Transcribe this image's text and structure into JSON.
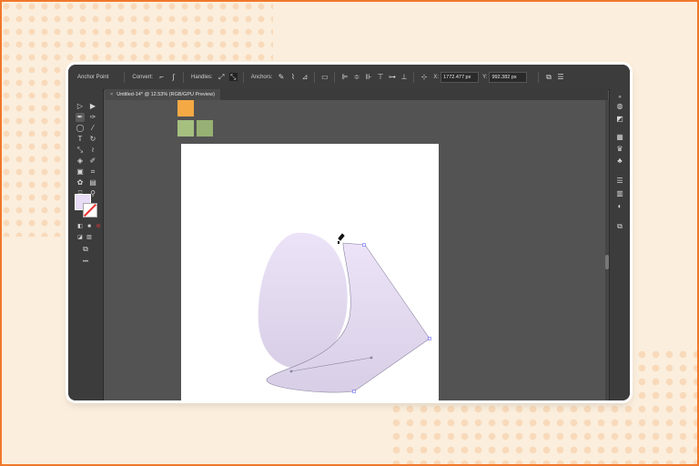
{
  "app": {
    "control_bar": {
      "anchor_point_label": "Anchor Point",
      "convert_label": "Convert:",
      "handles_label": "Handles:",
      "anchors_label": "Anchors:",
      "x_label": "X:",
      "x_value": "1772.477 px",
      "y_label": "Y:",
      "y_value": "992.382 px"
    },
    "document_tab": {
      "title": "Untitled-14* @ 12.53% (RGB/GPU Preview)",
      "close_glyph": "×"
    },
    "swatches": {
      "colors": [
        "#f5a945",
        "#a6c080",
        "#97b073"
      ]
    },
    "colors": {
      "fill": "#e8dcf6",
      "artwork_fill": "#e4d9f4",
      "artwork_stroke": "#8b83a0",
      "page_background": "#fbeedc",
      "accent": "#f0772b"
    },
    "tools_more": "•••"
  }
}
